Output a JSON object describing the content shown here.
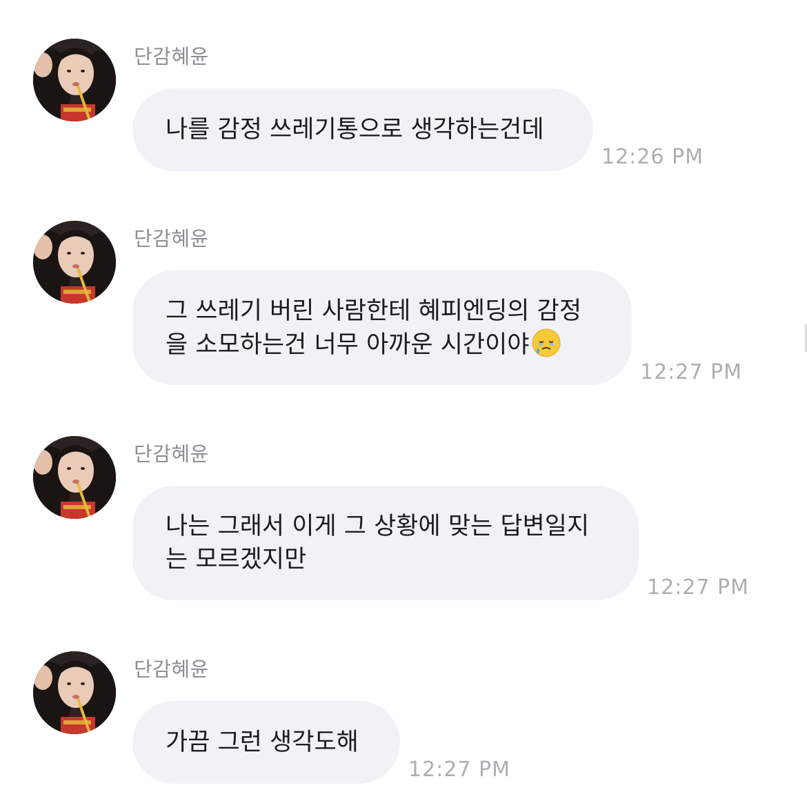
{
  "messages": [
    {
      "sender": "단감혜윤",
      "lines": [
        "나를 감정 쓰레기통으로 생각하는건데"
      ],
      "time": "12:26 PM"
    },
    {
      "sender": "단감혜윤",
      "lines": [
        "그 쓰레기 버린 사람한테 혜피엔딩의 감정",
        "을 소모하는건 너무 아까운 시간이야"
      ],
      "emoji": "face-holding-back-tears",
      "time": "12:27 PM"
    },
    {
      "sender": "단감혜윤",
      "lines": [
        "나는 그래서 이게 그 상황에 맞는 답변일지",
        "는 모르겠지만"
      ],
      "time": "12:27 PM"
    },
    {
      "sender": "단감혜윤",
      "lines": [
        "가끔 그런 생각도해"
      ],
      "time": "12:27 PM"
    }
  ],
  "colors": {
    "bubble": "#f2f2f6",
    "text": "#1c1c1e",
    "sender": "#8e8e93",
    "time": "#aeaeb2"
  }
}
